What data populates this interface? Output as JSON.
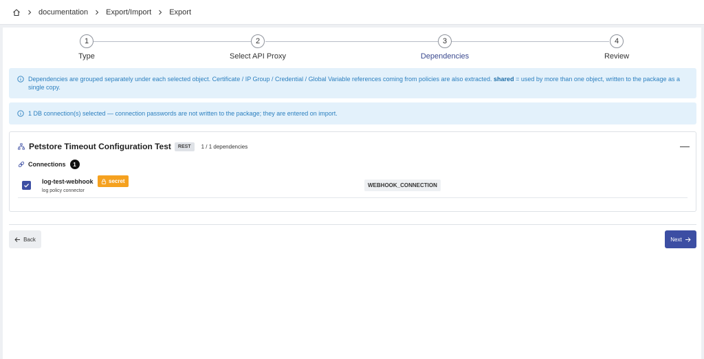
{
  "breadcrumb": {
    "home_icon": "home-icon",
    "items": [
      "documentation",
      "Export/Import",
      "Export"
    ]
  },
  "stepper": {
    "steps": [
      {
        "number": "1",
        "label": "Type"
      },
      {
        "number": "2",
        "label": "Select API Proxy"
      },
      {
        "number": "3",
        "label": "Dependencies"
      },
      {
        "number": "4",
        "label": "Review"
      }
    ],
    "active_step": 3
  },
  "info_banners": {
    "grouping_part1": "Dependencies are grouped separately under each selected object. Certificate / IP Group / Credential / Global Variable references coming from policies are also extracted. ",
    "grouping_bold": "shared",
    "grouping_part2": " = used by more than one object, written to the package as a single copy.",
    "db_connections": "1 DB connection(s) selected — connection passwords are not written to the package; they are entered on import."
  },
  "card": {
    "title": "Petstore Timeout Configuration Test",
    "badge": "REST",
    "dependencies_count": "1 / 1 dependencies",
    "collapse_label": "—",
    "section_label": "Connections",
    "section_count": "1",
    "rows": [
      {
        "name": "log-test-webhook",
        "description": "log policy connector",
        "secret_label": "secret",
        "type": "WEBHOOK_CONNECTION",
        "checked": true
      }
    ]
  },
  "footer": {
    "back_label": "Back",
    "next_label": "Next"
  },
  "colors": {
    "accent": "#3c4ea3",
    "info_bg": "#e3f1fb",
    "info_text": "#2b7fbf",
    "secret": "#f5a11f"
  }
}
